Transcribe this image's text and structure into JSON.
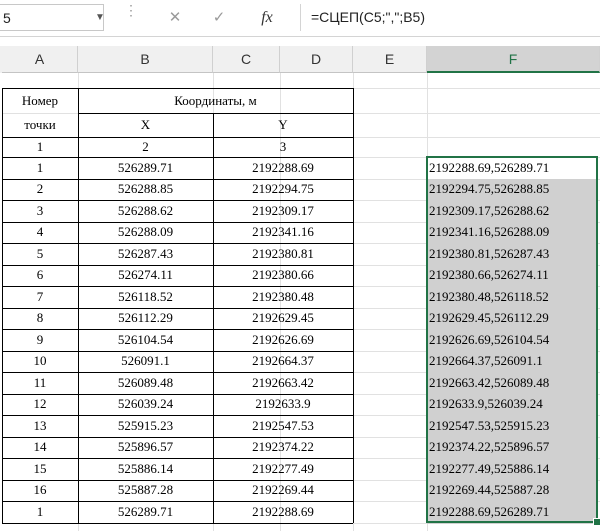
{
  "formula_bar": {
    "name_box": "5",
    "fx_label": "fx",
    "formula": "=СЦЕП(C5;\",\";B5)"
  },
  "columns": [
    "A",
    "B",
    "C",
    "D",
    "E",
    "F"
  ],
  "table": {
    "header_num_line1": "Номер",
    "header_num_line2": "точки",
    "header_coords": "Координаты, м",
    "header_x": "X",
    "header_y": "Y",
    "index_row": [
      "1",
      "2",
      "3"
    ],
    "rows": [
      {
        "n": "1",
        "x": "526289.71",
        "y": "2192288.69"
      },
      {
        "n": "2",
        "x": "526288.85",
        "y": "2192294.75"
      },
      {
        "n": "3",
        "x": "526288.62",
        "y": "2192309.17"
      },
      {
        "n": "4",
        "x": "526288.09",
        "y": "2192341.16"
      },
      {
        "n": "5",
        "x": "526287.43",
        "y": "2192380.81"
      },
      {
        "n": "6",
        "x": "526274.11",
        "y": "2192380.66"
      },
      {
        "n": "7",
        "x": "526118.52",
        "y": "2192380.48"
      },
      {
        "n": "8",
        "x": "526112.29",
        "y": "2192629.45"
      },
      {
        "n": "9",
        "x": "526104.54",
        "y": "2192626.69"
      },
      {
        "n": "10",
        "x": "526091.1",
        "y": "2192664.37"
      },
      {
        "n": "11",
        "x": "526089.48",
        "y": "2192663.42"
      },
      {
        "n": "12",
        "x": "526039.24",
        "y": "2192633.9"
      },
      {
        "n": "13",
        "x": "525915.23",
        "y": "2192547.53"
      },
      {
        "n": "14",
        "x": "525896.57",
        "y": "2192374.22"
      },
      {
        "n": "15",
        "x": "525886.14",
        "y": "2192277.49"
      },
      {
        "n": "16",
        "x": "525887.28",
        "y": "2192269.44"
      },
      {
        "n": "1",
        "x": "526289.71",
        "y": "2192288.69"
      }
    ]
  },
  "f_column": [
    "2192288.69,526289.71",
    "2192294.75,526288.85",
    "2192309.17,526288.62",
    "2192341.16,526288.09",
    "2192380.81,526287.43",
    "2192380.66,526274.11",
    "2192380.48,526118.52",
    "2192629.45,526112.29",
    "2192626.69,526104.54",
    "2192664.37,526091.1",
    "2192663.42,526089.48",
    "2192633.9,526039.24",
    "2192547.53,525915.23",
    "2192374.22,525896.57",
    "2192277.49,525886.14",
    "2192269.44,525887.28",
    "2192288.69,526289.71"
  ],
  "colors": {
    "selection_border": "#217346",
    "selection_fill": "#d0d0d0",
    "active_cell_fill": "#ffffff"
  }
}
